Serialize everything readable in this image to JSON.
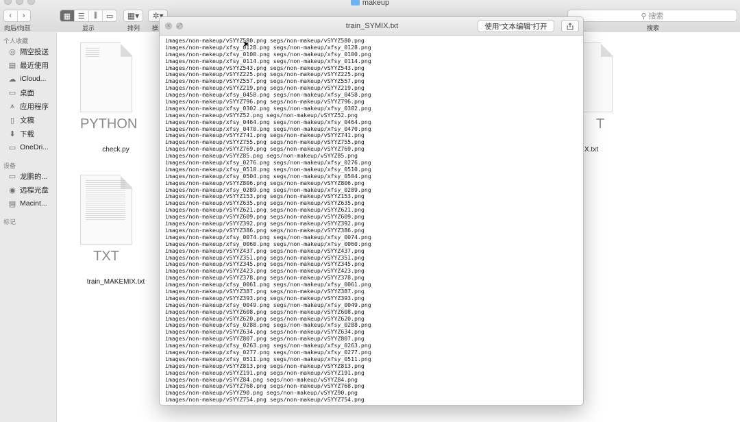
{
  "window": {
    "title": "makeup"
  },
  "toolbar": {
    "nav_label": "向后/向前",
    "view_label": "显示",
    "arrange_label": "排列",
    "action_label": "操",
    "search_placeholder": "搜索",
    "search_label": "搜索"
  },
  "sidebar": {
    "favorites_header": "个人收藏",
    "favorites": [
      {
        "label": "隔空投送",
        "icon": "airdrop-icon"
      },
      {
        "label": "最近使用",
        "icon": "recents-icon"
      },
      {
        "label": "iCloud...",
        "icon": "icloud-icon"
      },
      {
        "label": "桌面",
        "icon": "desktop-icon"
      },
      {
        "label": "应用程序",
        "icon": "applications-icon"
      },
      {
        "label": "文稿",
        "icon": "documents-icon"
      },
      {
        "label": "下载",
        "icon": "downloads-icon"
      },
      {
        "label": "OneDri...",
        "icon": "folder-icon"
      }
    ],
    "devices_header": "设备",
    "devices": [
      {
        "label": "龙鹏的...",
        "icon": "computer-icon"
      },
      {
        "label": "远程光盘",
        "icon": "disc-icon"
      },
      {
        "label": "Macint...",
        "icon": "disk-icon"
      }
    ],
    "tags_header": "标记"
  },
  "files": [
    {
      "name": "check.py",
      "badge": "PYTHON"
    },
    {
      "name": "train_MAKEMIX.txt",
      "badge": "TXT"
    },
    {
      "name": "X.txt",
      "badge": "T"
    }
  ],
  "quicklook": {
    "title": "train_SYMIX.txt",
    "open_button": "使用“文本编辑”打开",
    "lines": [
      "images/non-makeup/vSYYZ580.png segs/non-makeup/vSYYZ580.png",
      "images/non-makeup/xfsy_0128.png segs/non-makeup/xfsy_0128.png",
      "images/non-makeup/xfsy_0100.png segs/non-makeup/xfsy_0100.png",
      "images/non-makeup/xfsy_0114.png segs/non-makeup/xfsy_0114.png",
      "images/non-makeup/vSYYZ543.png segs/non-makeup/vSYYZ543.png",
      "images/non-makeup/vSYYZ225.png segs/non-makeup/vSYYZ225.png",
      "images/non-makeup/vSYYZ557.png segs/non-makeup/vSYYZ557.png",
      "images/non-makeup/vSYYZ219.png segs/non-makeup/vSYYZ219.png",
      "images/non-makeup/xfsy_0458.png segs/non-makeup/xfsy_0458.png",
      "images/non-makeup/vSYYZ796.png segs/non-makeup/vSYYZ796.png",
      "images/non-makeup/xfsy_0302.png segs/non-makeup/xfsy_0302.png",
      "images/non-makeup/vSYYZ52.png segs/non-makeup/vSYYZ52.png",
      "images/non-makeup/xfsy_0464.png segs/non-makeup/xfsy_0464.png",
      "images/non-makeup/xfsy_0470.png segs/non-makeup/xfsy_0470.png",
      "images/non-makeup/vSYYZ741.png segs/non-makeup/vSYYZ741.png",
      "images/non-makeup/vSYYZ755.png segs/non-makeup/vSYYZ755.png",
      "images/non-makeup/vSYYZ769.png segs/non-makeup/vSYYZ769.png",
      "images/non-makeup/vSYYZ85.png segs/non-makeup/vSYYZ85.png",
      "images/non-makeup/xfsy_0276.png segs/non-makeup/xfsy_0276.png",
      "images/non-makeup/xfsy_0510.png segs/non-makeup/xfsy_0510.png",
      "images/non-makeup/xfsy_0504.png segs/non-makeup/xfsy_0504.png",
      "images/non-makeup/vSYYZ806.png segs/non-makeup/vSYYZ806.png",
      "images/non-makeup/xfsy_0289.png segs/non-makeup/xfsy_0289.png",
      "images/non-makeup/vSYYZ153.png segs/non-makeup/vSYYZ153.png",
      "images/non-makeup/vSYYZ635.png segs/non-makeup/vSYYZ635.png",
      "images/non-makeup/vSYYZ621.png segs/non-makeup/vSYYZ621.png",
      "images/non-makeup/vSYYZ609.png segs/non-makeup/vSYYZ609.png",
      "images/non-makeup/vSYYZ392.png segs/non-makeup/vSYYZ392.png",
      "images/non-makeup/vSYYZ386.png segs/non-makeup/vSYYZ386.png",
      "images/non-makeup/xfsy_0074.png segs/non-makeup/xfsy_0074.png",
      "images/non-makeup/xfsy_0060.png segs/non-makeup/xfsy_0060.png",
      "images/non-makeup/vSYYZ437.png segs/non-makeup/vSYYZ437.png",
      "images/non-makeup/vSYYZ351.png segs/non-makeup/vSYYZ351.png",
      "images/non-makeup/vSYYZ345.png segs/non-makeup/vSYYZ345.png",
      "images/non-makeup/vSYYZ423.png segs/non-makeup/vSYYZ423.png",
      "images/non-makeup/vSYYZ378.png segs/non-makeup/vSYYZ378.png",
      "images/non-makeup/xfsy_0061.png segs/non-makeup/xfsy_0061.png",
      "images/non-makeup/vSYYZ387.png segs/non-makeup/vSYYZ387.png",
      "images/non-makeup/vSYYZ393.png segs/non-makeup/vSYYZ393.png",
      "images/non-makeup/xfsy_0049.png segs/non-makeup/xfsy_0049.png",
      "images/non-makeup/vSYYZ608.png segs/non-makeup/vSYYZ608.png",
      "images/non-makeup/vSYYZ620.png segs/non-makeup/vSYYZ620.png",
      "images/non-makeup/xfsy_0288.png segs/non-makeup/xfsy_0288.png",
      "images/non-makeup/vSYYZ634.png segs/non-makeup/vSYYZ634.png",
      "images/non-makeup/vSYYZ807.png segs/non-makeup/vSYYZ807.png",
      "images/non-makeup/xfsy_0263.png segs/non-makeup/xfsy_0263.png",
      "images/non-makeup/xfsy_0277.png segs/non-makeup/xfsy_0277.png",
      "images/non-makeup/xfsy_0511.png segs/non-makeup/xfsy_0511.png",
      "images/non-makeup/vSYYZ813.png segs/non-makeup/vSYYZ813.png",
      "images/non-makeup/vSYYZ191.png segs/non-makeup/vSYYZ191.png",
      "images/non-makeup/vSYYZ84.png segs/non-makeup/vSYYZ84.png",
      "images/non-makeup/vSYYZ768.png segs/non-makeup/vSYYZ768.png",
      "images/non-makeup/vSYYZ90.png segs/non-makeup/vSYYZ90.png",
      "images/non-makeup/vSYYZ754.png segs/non-makeup/vSYYZ754.png"
    ]
  }
}
